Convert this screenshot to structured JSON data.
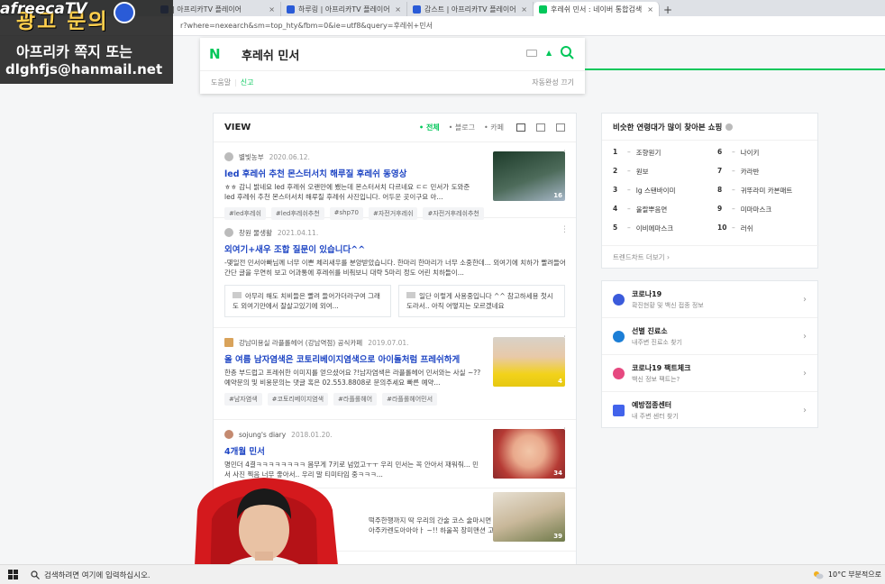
{
  "browser": {
    "tabs": [
      {
        "title": "| 아프리카TV 플레이어"
      },
      {
        "title": "하루링 | 아프리카TV 플레이어"
      },
      {
        "title": "감스트 | 아프리카TV 플레이어"
      },
      {
        "title": "후레쉬 민서 : 네이버 통합검색",
        "active": true
      }
    ],
    "new_tab": "+",
    "tab_close": "×",
    "address": "r?where=nexearch&sm=top_hty&fbm=0&ie=utf8&query=후레쉬+민서"
  },
  "overlay": {
    "logo": "afreecaTV",
    "title": "광고 문의",
    "line1": "아프리카 쪽지 또는",
    "line2": "dlghfjs@hanmail.net"
  },
  "search": {
    "logo": "N",
    "query": "후레쉬 민서",
    "help": "도움말",
    "report": "신고",
    "autocomplete": "자동완성 끄기"
  },
  "view": {
    "title": "VIEW",
    "filters": [
      "• 전체",
      "• 블로그",
      "• 카페"
    ],
    "posts": [
      {
        "author": "별빛농부",
        "date": "2020.06.12.",
        "title": "led 후레쉬 추천 몬스터서치 해루질 후레쉬 동영상",
        "desc": "ㅎㅎ 감니 밝네요 led 후레쉬 오랜만에 뵀는데 몬스터서치 다르네요 ㄷㄷ 민서가 도와준 led 후레쉬 추천 몬스터서치 해루질 후레쉬 사진입니다. 어두운 곳이구요 아...",
        "tags": [
          "#led후레쉬",
          "#led후레쉬추천",
          "#shp70",
          "#자전거후레쉬",
          "#자전거후레쉬추천"
        ],
        "count": "16"
      },
      {
        "author": "창원 물생활",
        "date": "2021.04.11.",
        "title": "외여기+새우 조합 질문이 있습니다^^",
        "desc": "-몇일전 민서아빠님께 너무 이쁜 체리새우를 분양받았습니다. 한마리 한마리가 너무 소중한데... 외여기에 치하가 빨려들어간단 글을 우연히 보고 어과통에 후레쉬를 비춰보니 대략 5마리 정도 어린 치하들이...",
        "subcards": [
          "아무리 해도 치비들은 빨려 들어가더라구여 그래도 외여기만에서 잘살고있기에 외여...",
          "일단 이렇게 사용중입니다 ^^ 참고하세용 첫시도라서.. 아직 어떻지는 모르겠네요"
        ]
      },
      {
        "author": "강남미용실 라플롤헤어 (강남역점) 공식카페",
        "date": "2019.07.01.",
        "title": "올 여름 남자염색은 코토리베이지염색으로 아이돌처럼 프레쉬하게",
        "desc": "한층 부드럽고 프레쉬한 이미지를 얻으셨어요 ?!남자염색은 라플롤헤어 민서와는 사실 ~?? 예약문의 및 비용문의는 댓글 혹은 02.553.8808로 문의주세요 빠른 예약...",
        "tags": [
          "#남자염색",
          "#코토리베이지염색",
          "#라플롤헤어",
          "#라플롤헤어민서"
        ],
        "count": "4"
      },
      {
        "author": "sojung's diary",
        "date": "2018.01.20.",
        "title": "4개월 민서",
        "desc": "명민더 4결ㅋㅋㅋㅋㅋㅋㅋㅋ 몸무게 7키로 넘었고ㅜㅜ 우리 민서는 꼭 안아서 재워줘... 민서 사진 찍음 너무 좋아서.. 우리 말 티미타임 중ㅋㅋㅋ...",
        "count": "34"
      },
      {
        "desc": "떡주한행까지 딱 우리의 간술 코스 술마시면 아주카렌도아아아ㅏ ~!! 하울꼭 장미맨션 고고...",
        "count": "39"
      }
    ]
  },
  "shopping": {
    "title": "비슷한 연령대가 많이 찾아본 쇼핑",
    "items": [
      {
        "rank": "1",
        "name": "조향원기"
      },
      {
        "rank": "2",
        "name": "원보"
      },
      {
        "rank": "3",
        "name": "lg 스탠바이미"
      },
      {
        "rank": "4",
        "name": "울랄뿌음면"
      },
      {
        "rank": "5",
        "name": "이비에마스크"
      },
      {
        "rank": "6",
        "name": "나이키"
      },
      {
        "rank": "7",
        "name": "카라반"
      },
      {
        "rank": "8",
        "name": "귀뚜라미 카본매트"
      },
      {
        "rank": "9",
        "name": "미마마스크"
      },
      {
        "rank": "10",
        "name": "러쉬"
      }
    ],
    "footer": "트렌드차트 더보기 ›"
  },
  "links": [
    {
      "title": "코로나19",
      "sub": "확진현황 및 백신 접종 정보",
      "color": "#3b5bdb"
    },
    {
      "title": "선별 진료소",
      "sub": "내주변 진료소 찾기",
      "color": "#1c7ed6"
    },
    {
      "title": "코로나19 팩트체크",
      "sub": "백신 정보 팩트는?",
      "color": "#e64980"
    },
    {
      "title": "예방접종센터",
      "sub": "내 주변 센터 찾기",
      "color": "#4263eb"
    }
  ],
  "taskbar": {
    "search_placeholder": "검색하려면 여기에 입력하십시오.",
    "weather": "10°C 부분적으로"
  }
}
